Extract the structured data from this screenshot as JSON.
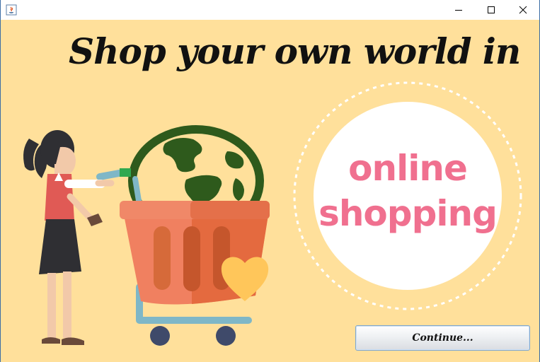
{
  "window": {
    "title": "",
    "app_icon": "java-coffee-icon",
    "controls": [
      "minimize-icon",
      "maximize-icon",
      "close-icon"
    ]
  },
  "main": {
    "headline": "Shop your own world in",
    "circle_line1": "online",
    "circle_line2": "shopping",
    "continue_label": "Continue..."
  },
  "colors": {
    "background": "#ffe09b",
    "circle": "#ffffff",
    "circle_text": "#f0708f",
    "basket": "#f08060",
    "globe": "#2e5a1c",
    "heart": "#ffc65a"
  },
  "illustration": {
    "subject": "woman pushing shopping cart with globe",
    "icons": [
      "woman-figure",
      "shopping-cart-icon",
      "globe-icon",
      "heart-icon"
    ]
  }
}
